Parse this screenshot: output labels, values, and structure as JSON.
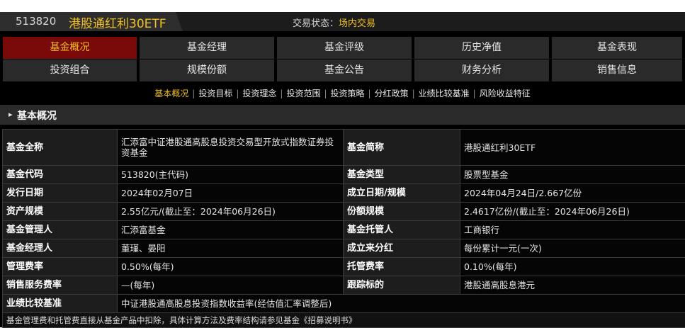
{
  "header": {
    "code": "513820",
    "fund_name": "港股通红利30ETF",
    "status_label": "交易状态：",
    "status_value": "场内交易"
  },
  "nav_row1": [
    "基金概况",
    "基金经理",
    "基金评级",
    "历史净值",
    "基金表现"
  ],
  "nav_row2": [
    "投资组合",
    "规模份额",
    "基金公告",
    "财务分析",
    "销售信息"
  ],
  "active_tab": "基金概况",
  "subnav": {
    "items": [
      "基本概况",
      "投资目标",
      "投资理念",
      "投资范围",
      "投资策略",
      "分红政策",
      "业绩比较基准",
      "风险收益特征"
    ],
    "separator": "|"
  },
  "section": {
    "arrow": "▸",
    "title": "基本概况"
  },
  "table": {
    "full_name_label": "基金全称",
    "full_name_value": "汇添富中证港股通高股息投资交易型开放式指数证券投资基金",
    "short_name_label": "基金简称",
    "short_name_value": "港股通红利30ETF",
    "code_label": "基金代码",
    "code_value": "513820(主代码)",
    "type_label": "基金类型",
    "type_value": "股票型基金",
    "issue_date_label": "发行日期",
    "issue_date_value": "2024年02月07日",
    "est_label": "成立日期/规模",
    "est_value": "2024年04月24日/2.667亿份",
    "asset_label": "资产规模",
    "asset_value": "2.55亿元/(截止至：2024年06月26日)",
    "share_label": "份额规模",
    "share_value": "2.4617亿份/(截止至：2024年06月26日)",
    "manager_co_label": "基金管理人",
    "manager_co_value": "汇添富基金",
    "custodian_label": "基金托管人",
    "custodian_value": "工商银行",
    "managers_label": "基金经理人",
    "managers_value": "董瑾、晏阳",
    "dividend_label": "成立来分红",
    "dividend_value": "每份累计一元(一次)",
    "mgmt_fee_label": "管理费率",
    "mgmt_fee_value": "0.50%(每年)",
    "custody_fee_label": "托管费率",
    "custody_fee_value": "0.10%(每年)",
    "sales_fee_label": "销售服务费率",
    "sales_fee_value": "—(每年)",
    "tracking_label": "跟踪标的",
    "tracking_value": "港股通高股息港元",
    "benchmark_label": "业绩比较基准",
    "benchmark_value": "中证港股通高股息投资指数收益率(经估值汇率调整后)",
    "footnote": "基金管理费和托管费直接从基金产品中扣除，具体计算方法及费率结构请参见基金《招募说明书》"
  }
}
